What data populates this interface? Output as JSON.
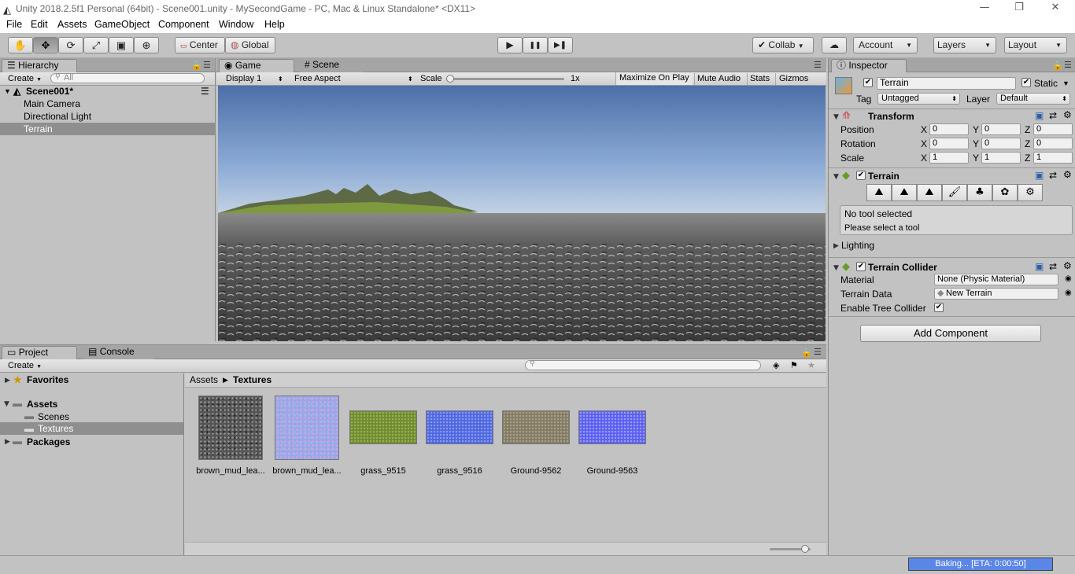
{
  "window": {
    "title": "Unity 2018.2.5f1 Personal (64bit) - Scene001.unity - MySecondGame - PC, Mac & Linux Standalone* <DX11>",
    "controls": [
      "—",
      "❐",
      "✕"
    ]
  },
  "menu": [
    "File",
    "Edit",
    "Assets",
    "GameObject",
    "Component",
    "Window",
    "Help"
  ],
  "toolbar": {
    "tools": [
      {
        "name": "hand-tool-icon",
        "glyph": "✋"
      },
      {
        "name": "move-tool-icon",
        "glyph": "✥"
      },
      {
        "name": "rotate-tool-icon",
        "glyph": "⟳"
      },
      {
        "name": "scale-tool-icon",
        "glyph": "⤢"
      },
      {
        "name": "rect-tool-icon",
        "glyph": "▣"
      },
      {
        "name": "transform-tool-icon",
        "glyph": "⊕"
      }
    ],
    "pivot": "Center",
    "space": "Global",
    "play": "▶",
    "pause": "❚❚",
    "step": "▶❚",
    "collab": "Collab",
    "cloud": "☁",
    "account": "Account",
    "layers": "Layers",
    "layout": "Layout"
  },
  "hierarchy": {
    "tab": "Hierarchy",
    "create": "Create",
    "search_placeholder": "All",
    "scene": "Scene001*",
    "items": [
      "Main Camera",
      "Directional Light",
      "Terrain"
    ],
    "selected_index": 2
  },
  "game": {
    "tabs": [
      "Game",
      "Scene"
    ],
    "display": "Display 1",
    "aspect": "Free Aspect",
    "scale_label": "Scale",
    "scale_value": "1x",
    "maximize": "Maximize On Play",
    "mute": "Mute Audio",
    "stats": "Stats",
    "gizmos": "Gizmos"
  },
  "project": {
    "tabs": [
      "Project",
      "Console"
    ],
    "create": "Create",
    "tree": {
      "favorites": "Favorites",
      "assets": "Assets",
      "scenes": "Scenes",
      "textures": "Textures",
      "packages": "Packages"
    },
    "breadcrumb": [
      "Assets",
      "Textures"
    ],
    "assets": [
      {
        "label": "brown_mud_lea...",
        "color": "#5a5a5a",
        "kind": "mud"
      },
      {
        "label": "brown_mud_lea...",
        "color": "#9aa6e8",
        "kind": "normal"
      },
      {
        "label": "grass_9515",
        "color": "#6f8a35",
        "kind": "grass"
      },
      {
        "label": "grass_9516",
        "color": "#4d66e0",
        "kind": "bluegrass"
      },
      {
        "label": "Ground-9562",
        "color": "#827a62",
        "kind": "ground"
      },
      {
        "label": "Ground-9563",
        "color": "#5a5ef0",
        "kind": "blueground"
      }
    ]
  },
  "inspector": {
    "tab": "Inspector",
    "object_name": "Terrain",
    "static_label": "Static",
    "tag_label": "Tag",
    "tag_value": "Untagged",
    "layer_label": "Layer",
    "layer_value": "Default",
    "transform": {
      "title": "Transform",
      "rows": [
        {
          "label": "Position",
          "x": "0",
          "y": "0",
          "z": "0"
        },
        {
          "label": "Rotation",
          "x": "0",
          "y": "0",
          "z": "0"
        },
        {
          "label": "Scale",
          "x": "1",
          "y": "1",
          "z": "1"
        }
      ]
    },
    "terrain": {
      "title": "Terrain",
      "no_tool": "No tool selected",
      "please": "Please select a tool",
      "lighting": "Lighting"
    },
    "collider": {
      "title": "Terrain Collider",
      "material_label": "Material",
      "material_value": "None (Physic Material)",
      "data_label": "Terrain Data",
      "data_value": "New Terrain",
      "tree_label": "Enable Tree Collider"
    },
    "add_component": "Add Component"
  },
  "status": {
    "baking": "Baking... [ETA: 0:00:50]"
  },
  "axis": {
    "x": "X",
    "y": "Y",
    "z": "Z"
  }
}
